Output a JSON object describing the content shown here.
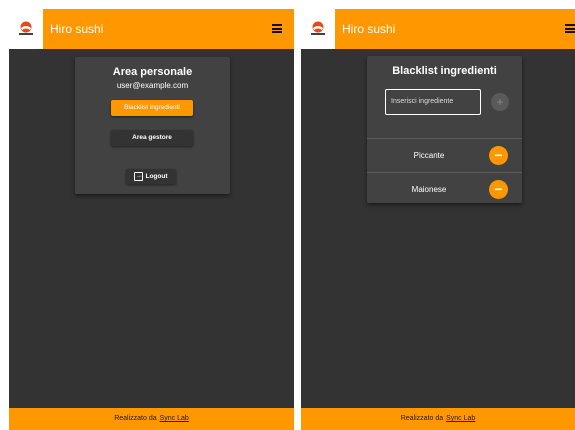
{
  "left_screen": {
    "header": {
      "brand": "Hiro sushi"
    },
    "profile": {
      "title": "Area personale",
      "email": "user@example.com",
      "blacklist_button": "Blacklist ingredienti",
      "manager_button": "Area gestore",
      "logout_button": "Logout"
    },
    "footer": {
      "text": "Realizzato da",
      "link": "Sync Lab"
    }
  },
  "right_screen": {
    "header": {
      "brand": "Hiro sushi"
    },
    "blacklist": {
      "title": "Blacklist ingredienti",
      "input_placeholder": "Inserisci ingrediente",
      "add_symbol": "+",
      "remove_symbol": "−",
      "items": [
        {
          "label": "Piccante"
        },
        {
          "label": "Maionese"
        }
      ]
    },
    "footer": {
      "text": "Realizzato da",
      "link": "Sync Lab"
    }
  },
  "colors": {
    "accent": "#ff9800",
    "background": "#333333",
    "card": "#424242"
  }
}
